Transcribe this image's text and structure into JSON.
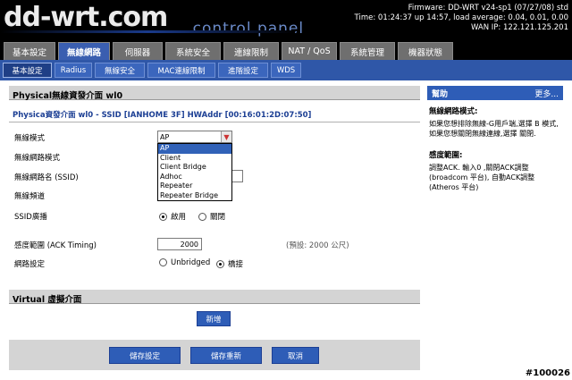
{
  "header": {
    "logo": "dd-wrt.com",
    "logo_sub": "... control panel",
    "firmware": "Firmware: DD-WRT v24-sp1 (07/27/08) std",
    "uptime": "Time: 01:24:37 up 14:57, load average: 0.04, 0.01, 0.00",
    "wan_ip": "WAN IP: 122.121.125.201"
  },
  "main_tabs": [
    "基本設定",
    "無線網路",
    "伺服器",
    "系統安全",
    "連線限制",
    "NAT / QoS",
    "系統管理",
    "機器狀態"
  ],
  "sub_tabs": [
    "基本設定",
    "Radius",
    "無線安全",
    "MAC連線限制",
    "進階設定",
    "WDS"
  ],
  "section_title": "Physical無線資發介面 wl0",
  "fieldset_title": "Physica資發介面 wl0 - SSID [IANHOME 3F] HWAddr [00:16:01:2D:07:50]",
  "fields": {
    "mode_label": "無線模式",
    "network_mode_label": "無線網路模式",
    "ssid_label": "無線網路名 (SSID)",
    "channel_label": "無線頻道",
    "ssid_broadcast_label": "SSID廣播",
    "ack_label": "感度範圍 (ACK Timing)",
    "network_config_label": "網路設定"
  },
  "mode_select": {
    "value": "AP",
    "options": [
      "AP",
      "Client",
      "Client Bridge",
      "Adhoc",
      "Repeater",
      "Repeater Bridge"
    ]
  },
  "ssid_broadcast": {
    "enable": "啟用",
    "disable": "關閉"
  },
  "ack": {
    "value": "2000",
    "hint": "(預設: 2000 公尺)"
  },
  "network_config": {
    "unbridged": "Unbridged",
    "bridged": "橋接"
  },
  "virtual": {
    "title": "Virtual 虛擬介面",
    "add_button": "新增"
  },
  "buttons": {
    "save": "儲存設定",
    "apply": "儲存重新",
    "cancel": "取消"
  },
  "help": {
    "title": "幫助",
    "more": "更多...",
    "t1": "無線網路模式:",
    "p1": "如果您想排除無線-G用戶端,選擇 B 模式,如果您想關閉無線連線,選擇 關閉.",
    "t2": "感度範圍:",
    "p2": "調整ACK. 輸入0 ,關閉ACK調整 (broadcom 平台), 自動ACK調整 (Atheros 平台)"
  },
  "watermark": "#100026"
}
